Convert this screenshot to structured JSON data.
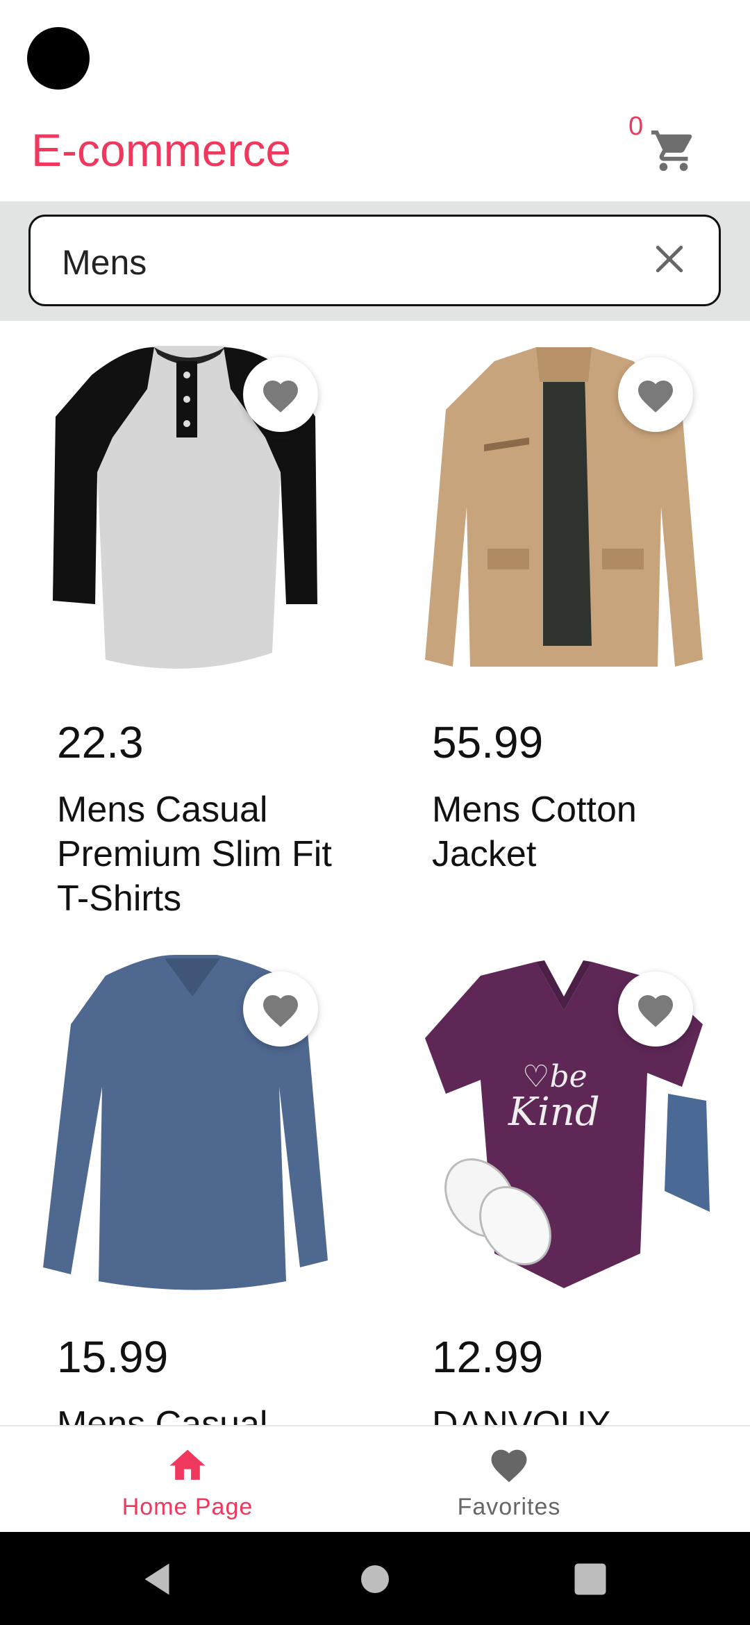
{
  "app_bar": {
    "title": "E-commerce",
    "cart_count": "0",
    "cart_icon": "shopping-cart-icon"
  },
  "search": {
    "value": "Mens",
    "clear_icon": "close-icon"
  },
  "products": [
    {
      "price": "22.3",
      "name": "Mens Casual Premium Slim Fit T-Shirts",
      "image": "raglan-henley-tshirt-image",
      "favorite_icon": "heart-icon"
    },
    {
      "price": "55.99",
      "name": "Mens Cotton Jacket",
      "image": "khaki-cotton-jacket-image",
      "favorite_icon": "heart-icon"
    },
    {
      "price": "15.99",
      "name": "Mens Casual",
      "image": "blue-long-sleeve-tshirt-image",
      "favorite_icon": "heart-icon"
    },
    {
      "price": "12.99",
      "name": "DANVOUY",
      "image": "purple-be-kind-tshirt-image",
      "favorite_icon": "heart-icon"
    }
  ],
  "bottom_nav": {
    "items": [
      {
        "label": "Home Page",
        "icon": "home-icon",
        "active": true
      },
      {
        "label": "Favorites",
        "icon": "heart-icon",
        "active": false
      }
    ]
  },
  "colors": {
    "accent": "#f0385e",
    "search_band": "#e2e3e3",
    "icon_gray": "#7a7a7a"
  }
}
